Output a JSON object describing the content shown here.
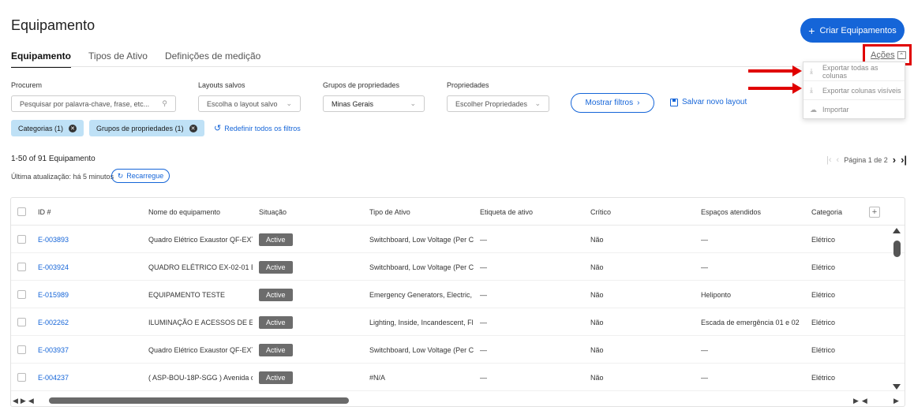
{
  "page": {
    "title": "Equipamento"
  },
  "header": {
    "create_button_label": "Criar Equipamentos",
    "create_icon": "plus-icon"
  },
  "tabs": [
    {
      "label": "Equipamento",
      "active": true
    },
    {
      "label": "Tipos de Ativo",
      "active": false
    },
    {
      "label": "Definições de medição",
      "active": false
    }
  ],
  "actions": {
    "label": "Ações",
    "menu": [
      {
        "label": "Exportar todas as colunas",
        "icon": "download-icon"
      },
      {
        "label": "Exportar colunas visíveis",
        "icon": "download-icon"
      },
      {
        "label": "Importar",
        "icon": "upload-cloud-icon"
      }
    ]
  },
  "filters": {
    "search_label": "Procurem",
    "search_placeholder": "Pesquisar por palavra-chave, frase, etc...",
    "layouts_label": "Layouts salvos",
    "layouts_value": "Escolha o layout salvo",
    "groups_label": "Grupos de propriedades",
    "groups_value": "Minas Gerais",
    "properties_label": "Propriedades",
    "properties_value": "Escolher Propriedades",
    "show_filters_label": "Mostrar filtros",
    "save_layout_label": "Salvar novo layout",
    "chips": [
      "Categorias (1)",
      "Grupos de propriedades (1)"
    ],
    "reset_label": "Redefinir todos os filtros"
  },
  "summary": {
    "count": "1-50 of 91 Equipamento",
    "updated": "Última atualização: há 5 minutos",
    "reload_label": "Recarregue",
    "page": "Página 1 de 2"
  },
  "table": {
    "columns": [
      "ID #",
      "Nome do equipamento",
      "Situação",
      "Tipo de Ativo",
      "Etiqueta de ativo",
      "Crítico",
      "Espaços atendidos",
      "Categoria"
    ],
    "rows": [
      {
        "id": "E-003893",
        "name": "Quadro Elétrico Exaustor QF-EXT-...",
        "status": "Active",
        "type": "Switchboard, Low Voltage (Per C...",
        "tag": "—",
        "critical": "Não",
        "spaces": "—",
        "category": "Elétrico"
      },
      {
        "id": "E-003924",
        "name": "QUADRO ELÉTRICO EX-02-01 BO...",
        "status": "Active",
        "type": "Switchboard, Low Voltage (Per C...",
        "tag": "—",
        "critical": "Não",
        "spaces": "—",
        "category": "Elétrico"
      },
      {
        "id": "E-015989",
        "name": "EQUIPAMENTO TESTE",
        "status": "Active",
        "type": "Emergency Generators, Electric, ...",
        "tag": "—",
        "critical": "Não",
        "spaces": "Heliponto",
        "category": "Elétrico"
      },
      {
        "id": "E-002262",
        "name": "ILUMINAÇÃO E ACESSOS DE EM...",
        "status": "Active",
        "type": "Lighting, Inside, Incandescent, Fl...",
        "tag": "—",
        "critical": "Não",
        "spaces": "Escada de emergência 01 e 02",
        "category": "Elétrico"
      },
      {
        "id": "E-003937",
        "name": "Quadro Elétrico Exaustor QF-EXT-...",
        "status": "Active",
        "type": "Switchboard, Low Voltage (Per C...",
        "tag": "—",
        "critical": "Não",
        "spaces": "—",
        "category": "Elétrico"
      },
      {
        "id": "E-004237",
        "name": "( ASP-BOU-18P-SGG ) Avenida do...",
        "status": "Active",
        "type": "#N/A",
        "tag": "—",
        "critical": "Não",
        "spaces": "—",
        "category": "Elétrico"
      }
    ]
  },
  "colors": {
    "accent": "#1565d8",
    "annotation": "#e00000",
    "badge": "#6c6c6c",
    "chip": "#bfe1f6"
  }
}
